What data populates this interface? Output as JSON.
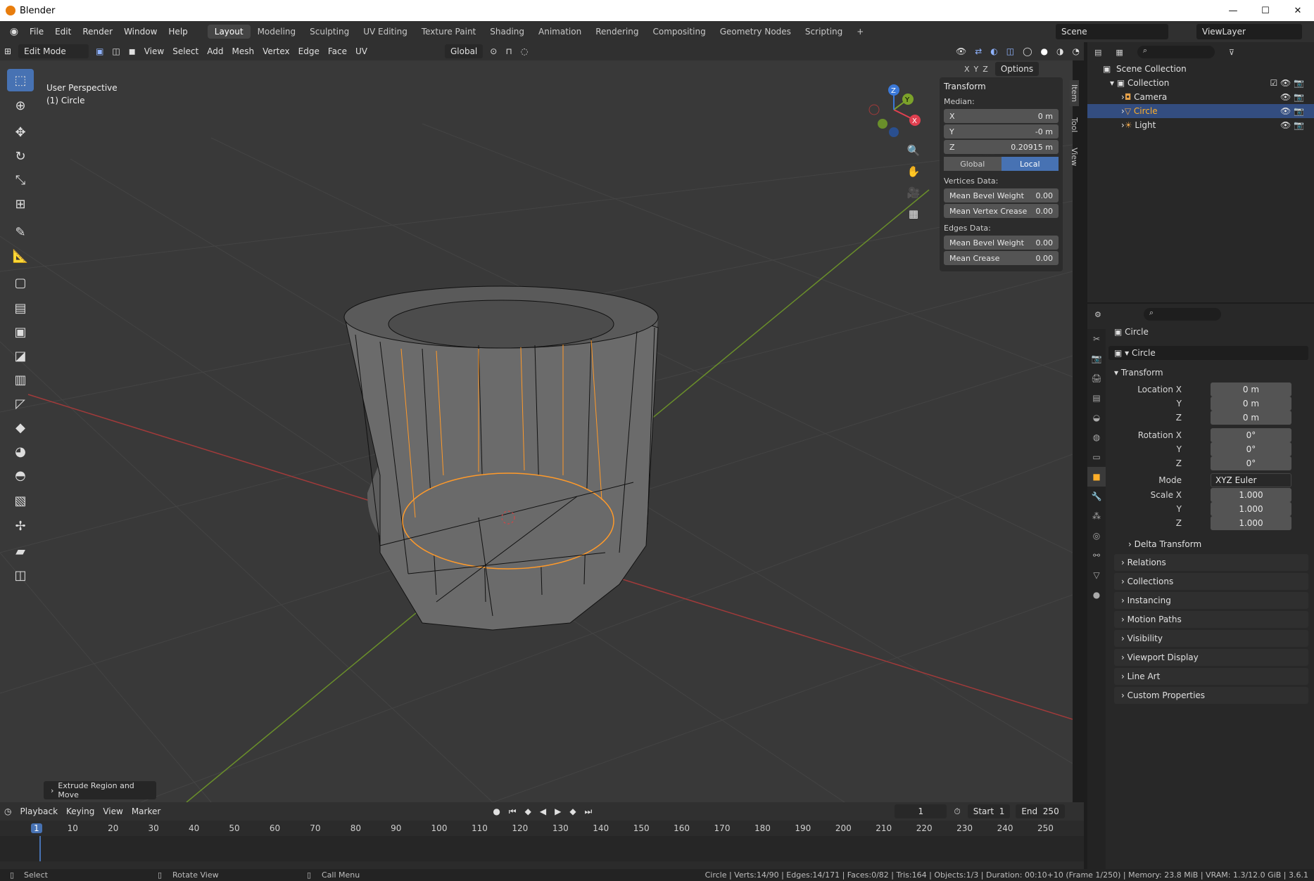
{
  "window": {
    "title": "Blender",
    "min": "—",
    "max": "☐",
    "close": "✕"
  },
  "menu": [
    "File",
    "Edit",
    "Render",
    "Window",
    "Help"
  ],
  "workspaces": [
    "Layout",
    "Modeling",
    "Sculpting",
    "UV Editing",
    "Texture Paint",
    "Shading",
    "Animation",
    "Rendering",
    "Compositing",
    "Geometry Nodes",
    "Scripting"
  ],
  "workspace_add": "+",
  "scene": "Scene",
  "view_layer": "ViewLayer",
  "vp_header": {
    "mode": "Edit Mode",
    "menus": [
      "View",
      "Select",
      "Add",
      "Mesh",
      "Vertex",
      "Edge",
      "Face",
      "UV"
    ],
    "orientation": "Global",
    "options": "Options",
    "axes": [
      "X",
      "Y",
      "Z"
    ]
  },
  "viewport": {
    "perspective": "User Perspective",
    "object": "(1) Circle"
  },
  "npanel": {
    "title": "Transform",
    "median": "Median:",
    "x_label": "X",
    "x": "0 m",
    "y_label": "Y",
    "y": "-0 m",
    "z_label": "Z",
    "z": "0.20915 m",
    "global": "Global",
    "local": "Local",
    "vertices_data": "Vertices Data:",
    "mean_bevel_weight": "Mean Bevel Weight",
    "mbw_v": "0.00",
    "mean_vertex_crease": "Mean Vertex Crease",
    "mvc_v": "0.00",
    "edges_data": "Edges Data:",
    "mean_bevel_weight_e": "Mean Bevel Weight",
    "mbw_e": "0.00",
    "mean_crease": "Mean Crease",
    "mc_v": "0.00",
    "tabs": [
      "Item",
      "Tool",
      "View"
    ]
  },
  "gizmo": {
    "x": "X",
    "y": "Y",
    "z": "Z"
  },
  "last_op": "Extrude Region and Move",
  "timeline": {
    "menus": [
      "Playback",
      "Keying",
      "View",
      "Marker"
    ],
    "current": "1",
    "start_label": "Start",
    "start": "1",
    "end_label": "End",
    "end": "250",
    "ticks": [
      "1",
      "10",
      "20",
      "30",
      "40",
      "50",
      "60",
      "70",
      "80",
      "90",
      "100",
      "110",
      "120",
      "130",
      "140",
      "150",
      "160",
      "170",
      "180",
      "190",
      "200",
      "210",
      "220",
      "230",
      "240",
      "250"
    ]
  },
  "status": {
    "select": "Select",
    "rotate": "Rotate View",
    "call_menu": "Call Menu",
    "info": "Circle | Verts:14/90 | Edges:14/171 | Faces:0/82 | Tris:164 | Objects:1/3 | Duration: 00:10+10 (Frame 1/250) | Memory: 23.8 MiB | VRAM: 1.3/12.0 GiB | 3.6.1"
  },
  "outliner": {
    "scene_collection": "Scene Collection",
    "collection": "Collection",
    "items": [
      "Camera",
      "Circle",
      "Light"
    ]
  },
  "properties": {
    "object_name": "Circle",
    "data_name": "Circle",
    "transform": "Transform",
    "location_x_label": "Location X",
    "lx": "0 m",
    "y_label": "Y",
    "ly": "0 m",
    "z_label": "Z",
    "lz": "0 m",
    "rotation_x_label": "Rotation X",
    "rx": "0°",
    "ry": "0°",
    "rz": "0°",
    "mode_label": "Mode",
    "mode": "XYZ Euler",
    "scale_x_label": "Scale X",
    "sx": "1.000",
    "sy": "1.000",
    "sz": "1.000",
    "delta": "Delta Transform",
    "sections": [
      "Relations",
      "Collections",
      "Instancing",
      "Motion Paths",
      "Visibility",
      "Viewport Display",
      "Line Art",
      "Custom Properties"
    ]
  }
}
